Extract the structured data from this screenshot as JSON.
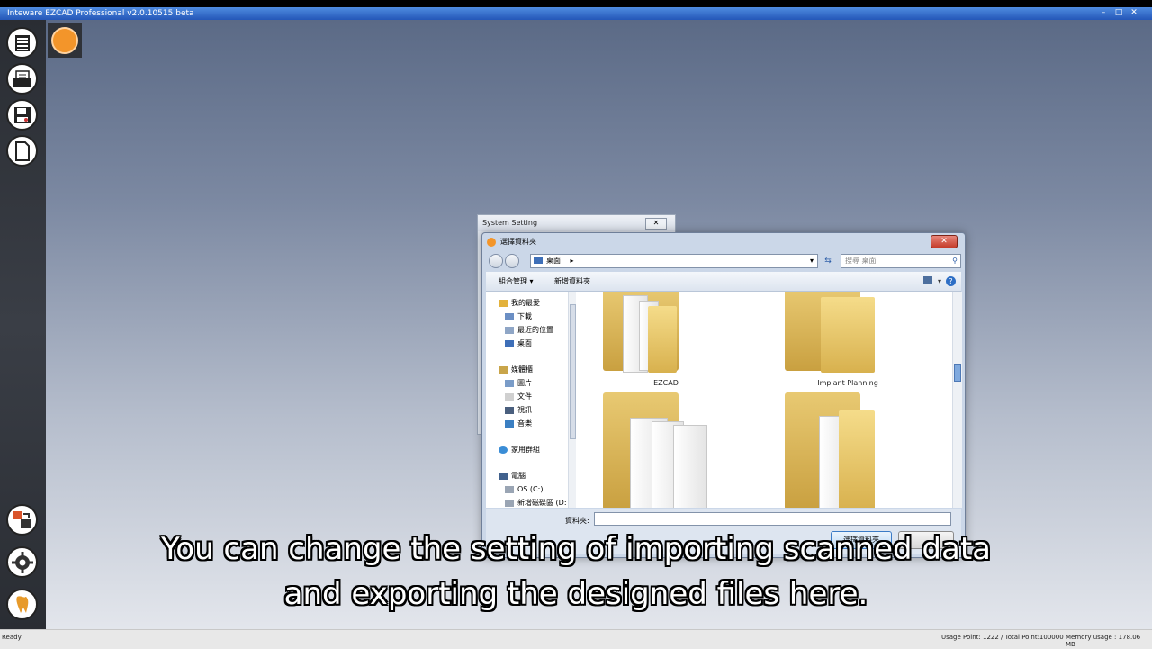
{
  "app": {
    "title": "Inteware EZCAD Professional v2.0.10515 beta",
    "window_controls": [
      "–",
      "□",
      "✕"
    ]
  },
  "sidebar": {
    "top_buttons": [
      {
        "name": "menu-list-icon"
      },
      {
        "name": "open-file-icon"
      },
      {
        "name": "save-icon"
      },
      {
        "name": "new-file-icon"
      }
    ],
    "bottom_buttons": [
      {
        "name": "import-export-icon"
      },
      {
        "name": "settings-gear-icon"
      },
      {
        "name": "tooth-icon"
      }
    ]
  },
  "system_setting": {
    "title": "System Setting",
    "close": "✕"
  },
  "picker": {
    "title": "選擇資料夾",
    "close": "✕",
    "address": "桌面",
    "address_arrow": "▸",
    "dropdown_arrow": "▾",
    "refresh": "⇆",
    "search_placeholder": "搜尋 桌面",
    "search_icon": "⚲",
    "toolbar": {
      "organize": "組合管理 ▾",
      "new_folder": "新增資料夾",
      "view_arrow": "▾",
      "help": "?"
    },
    "nav": [
      {
        "label": "我的最愛",
        "icon": "star-icon",
        "indent": 0
      },
      {
        "label": "下載",
        "icon": "download-icon",
        "indent": 1
      },
      {
        "label": "最近的位置",
        "icon": "recent-places-icon",
        "indent": 1
      },
      {
        "label": "桌面",
        "icon": "desktop-icon",
        "indent": 1
      },
      {
        "label": "媒體櫃",
        "icon": "library-icon",
        "indent": 0
      },
      {
        "label": "圖片",
        "icon": "pictures-icon",
        "indent": 1
      },
      {
        "label": "文件",
        "icon": "documents-icon",
        "indent": 1
      },
      {
        "label": "視訊",
        "icon": "videos-icon",
        "indent": 1
      },
      {
        "label": "音樂",
        "icon": "music-icon",
        "indent": 1
      },
      {
        "label": "家用群組",
        "icon": "homegroup-icon",
        "indent": 0
      },
      {
        "label": "電腦",
        "icon": "computer-icon",
        "indent": 0
      },
      {
        "label": "OS (C:)",
        "icon": "drive-c-icon",
        "indent": 1
      },
      {
        "label": "新增磁碟區 (D:",
        "icon": "drive-d-icon",
        "indent": 1
      }
    ],
    "folders": [
      {
        "label": "EZCAD"
      },
      {
        "label": "Implant Planning"
      },
      {
        "label": ""
      },
      {
        "label": ""
      }
    ],
    "footer": {
      "folder_label": "資料夾:",
      "ok": "選擇資料夾"
    }
  },
  "status": {
    "ready": "Ready",
    "usage": "Usage Point: 1222 / Total Point:100000",
    "memory": "Memory usage : 178.06 MB"
  },
  "caption": {
    "line1": "You can change the setting of importing scanned data",
    "line2": "and exporting the designed files here."
  }
}
